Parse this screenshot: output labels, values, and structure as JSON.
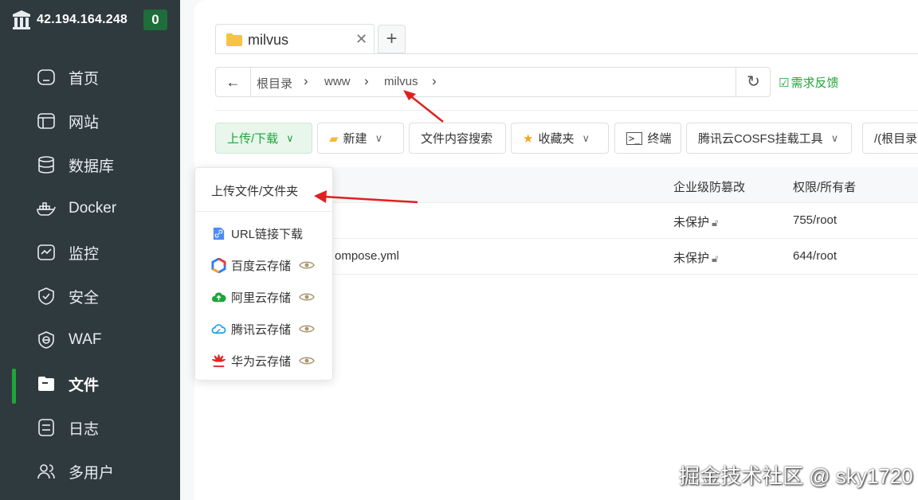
{
  "sidebar": {
    "server_ip": "42.194.164.248",
    "badge_count": "0",
    "items": [
      {
        "label": "首页",
        "icon": "home-icon"
      },
      {
        "label": "网站",
        "icon": "website-icon"
      },
      {
        "label": "数据库",
        "icon": "database-icon"
      },
      {
        "label": "Docker",
        "icon": "docker-icon"
      },
      {
        "label": "监控",
        "icon": "monitor-icon"
      },
      {
        "label": "安全",
        "icon": "shield-icon"
      },
      {
        "label": "WAF",
        "icon": "waf-icon"
      },
      {
        "label": "文件",
        "icon": "folder-icon",
        "active": true
      },
      {
        "label": "日志",
        "icon": "log-icon"
      },
      {
        "label": "多用户",
        "icon": "users-icon"
      }
    ]
  },
  "tabs": [
    {
      "label": "milvus"
    }
  ],
  "tab_add": "+",
  "path": {
    "crumbs": [
      "根目录",
      "www",
      "milvus"
    ],
    "feedback": "需求反馈"
  },
  "toolbar": {
    "upload_download": "上传/下载",
    "new": "新建",
    "content_search": "文件内容搜索",
    "favorites": "收藏夹",
    "terminal": "终端",
    "cosfs": "腾讯云COSFS挂载工具",
    "path_input": "/(根目录"
  },
  "table": {
    "headers": {
      "protect": "企业级防篡改",
      "perm": "权限/所有者"
    },
    "rows": [
      {
        "name": "",
        "protect": "未保护",
        "perm": "755/root"
      },
      {
        "name": "ompose.yml",
        "protect": "未保护",
        "perm": "644/root"
      }
    ]
  },
  "dropdown": {
    "header": "上传文件/文件夹",
    "items": [
      {
        "label": "URL链接下载",
        "icon": "link-icon"
      },
      {
        "label": "百度云存储",
        "icon": "baidu-cloud-icon"
      },
      {
        "label": "阿里云存储",
        "icon": "aliyun-cloud-icon"
      },
      {
        "label": "腾讯云存储",
        "icon": "tencent-cloud-icon"
      },
      {
        "label": "华为云存储",
        "icon": "huawei-cloud-icon"
      }
    ]
  },
  "watermark": "掘金技术社区 @ sky1720",
  "colors": {
    "accent": "#20a53a",
    "sidebar": "#2f3a3f",
    "arrow": "#e02020"
  }
}
